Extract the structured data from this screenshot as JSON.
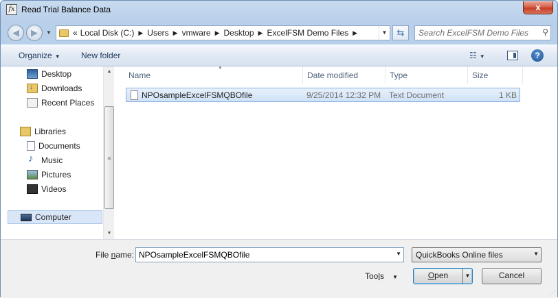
{
  "window": {
    "title": "Read Trial Balance Data",
    "close_label": "x"
  },
  "address_bar": {
    "overflow": "«",
    "path": [
      "Local Disk (C:)",
      "Users",
      "vmware",
      "Desktop",
      "ExcelFSM Demo Files"
    ],
    "separator": "▶"
  },
  "search": {
    "placeholder": "Search ExcelFSM Demo Files"
  },
  "toolbar": {
    "organize_label": "Organize",
    "new_folder_label": "New folder"
  },
  "nav_pane": {
    "favorites": [
      {
        "label": "Desktop",
        "icon": "desktop-icon"
      },
      {
        "label": "Downloads",
        "icon": "downloads-icon"
      },
      {
        "label": "Recent Places",
        "icon": "recent-places-icon"
      }
    ],
    "libraries_label": "Libraries",
    "libraries": [
      {
        "label": "Documents",
        "icon": "documents-icon"
      },
      {
        "label": "Music",
        "icon": "music-icon"
      },
      {
        "label": "Pictures",
        "icon": "pictures-icon"
      },
      {
        "label": "Videos",
        "icon": "videos-icon"
      }
    ],
    "computer_label": "Computer"
  },
  "file_list": {
    "columns": {
      "name": "Name",
      "date_modified": "Date modified",
      "type": "Type",
      "size": "Size"
    },
    "rows": [
      {
        "name": "NPOsampleExcelFSMQBOfile",
        "date_modified": "9/25/2014 12:32 PM",
        "type": "Text Document",
        "size": "1 KB"
      }
    ]
  },
  "bottom": {
    "file_name_label_pre": "File ",
    "file_name_label_accel": "n",
    "file_name_label_post": "ame:",
    "file_name_value": "NPOsampleExcelFSMQBOfile",
    "file_type_value": "QuickBooks Online files",
    "tools_label_pre": "Too",
    "tools_label_accel": "l",
    "tools_label_post": "s",
    "open_label_pre": "",
    "open_label_accel": "O",
    "open_label_post": "pen",
    "cancel_label": "Cancel"
  },
  "colors": {
    "frame": "#bcd2eb",
    "selection": "#cfe2f7",
    "close_button": "#c33c22"
  }
}
